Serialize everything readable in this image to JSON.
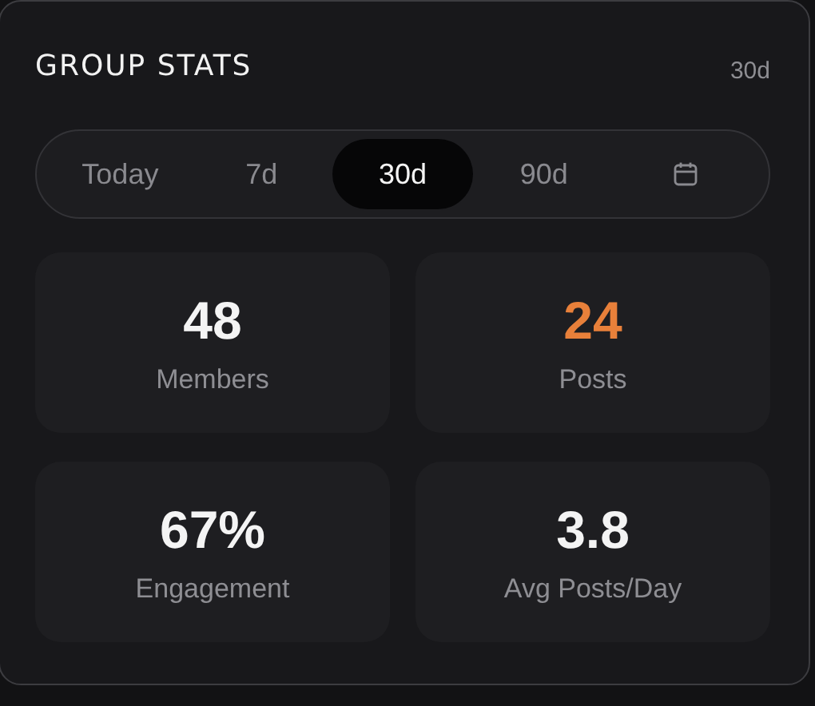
{
  "header": {
    "title": "GROUP STATS",
    "range": "30d"
  },
  "tabs": [
    {
      "kind": "text",
      "label": "Today",
      "selected": false
    },
    {
      "kind": "text",
      "label": "7d",
      "selected": false
    },
    {
      "kind": "text",
      "label": "30d",
      "selected": true
    },
    {
      "kind": "text",
      "label": "90d",
      "selected": false
    },
    {
      "kind": "calendar",
      "selected": false
    }
  ],
  "stats": [
    {
      "value": "48",
      "label": "Members",
      "accent": false
    },
    {
      "value": "24",
      "label": "Posts",
      "accent": true
    },
    {
      "value": "67%",
      "label": "Engagement",
      "accent": false
    },
    {
      "value": "3.8",
      "label": "Avg Posts/Day",
      "accent": false
    }
  ]
}
